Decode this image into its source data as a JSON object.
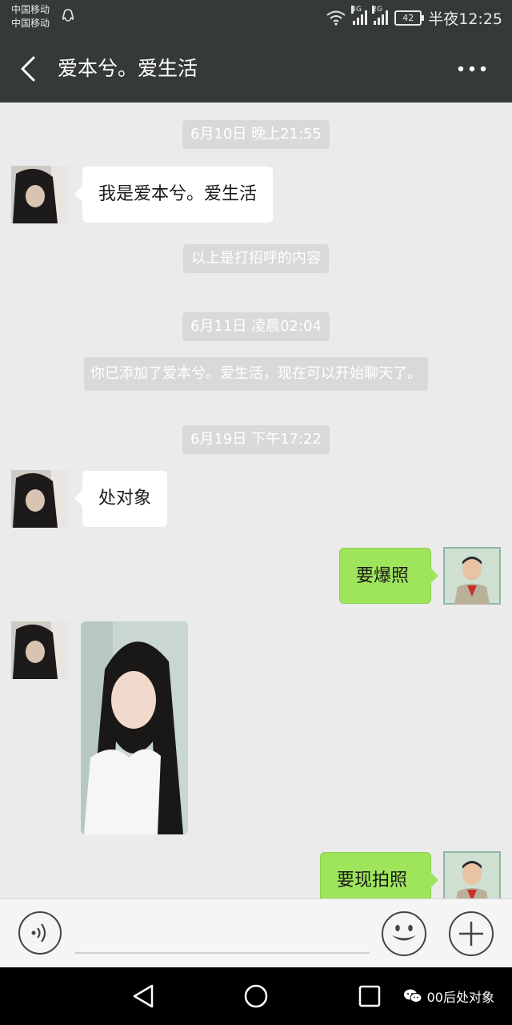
{
  "status_bar": {
    "carrier_1": "中国移动",
    "carrier_2": "中国移动",
    "net_1": "4G",
    "net_2": "2G",
    "battery": "42",
    "time": "半夜12:25"
  },
  "header": {
    "title": "爱本兮。爱生活"
  },
  "chat": {
    "timestamps": [
      "6月10日 晚上21:55",
      "6月11日 凌晨02:04",
      "6月19日 下午17:22"
    ],
    "greeting_note": "以上是打招呼的内容",
    "added_note": "你已添加了爱本兮。爱生活，现在可以开始聊天了。",
    "messages": [
      {
        "side": "in",
        "text": "我是爱本兮。爱生活"
      },
      {
        "side": "in",
        "text": "处对象"
      },
      {
        "side": "out",
        "text": "要爆照"
      },
      {
        "side": "in",
        "type": "image"
      },
      {
        "side": "out",
        "text": "要现拍照"
      }
    ]
  },
  "watermark": {
    "text": "00后处对象"
  },
  "colors": {
    "bar": "#36393a",
    "chat_bg": "#ebebeb",
    "out_bubble": "#9fe55c",
    "in_bubble": "#ffffff"
  }
}
